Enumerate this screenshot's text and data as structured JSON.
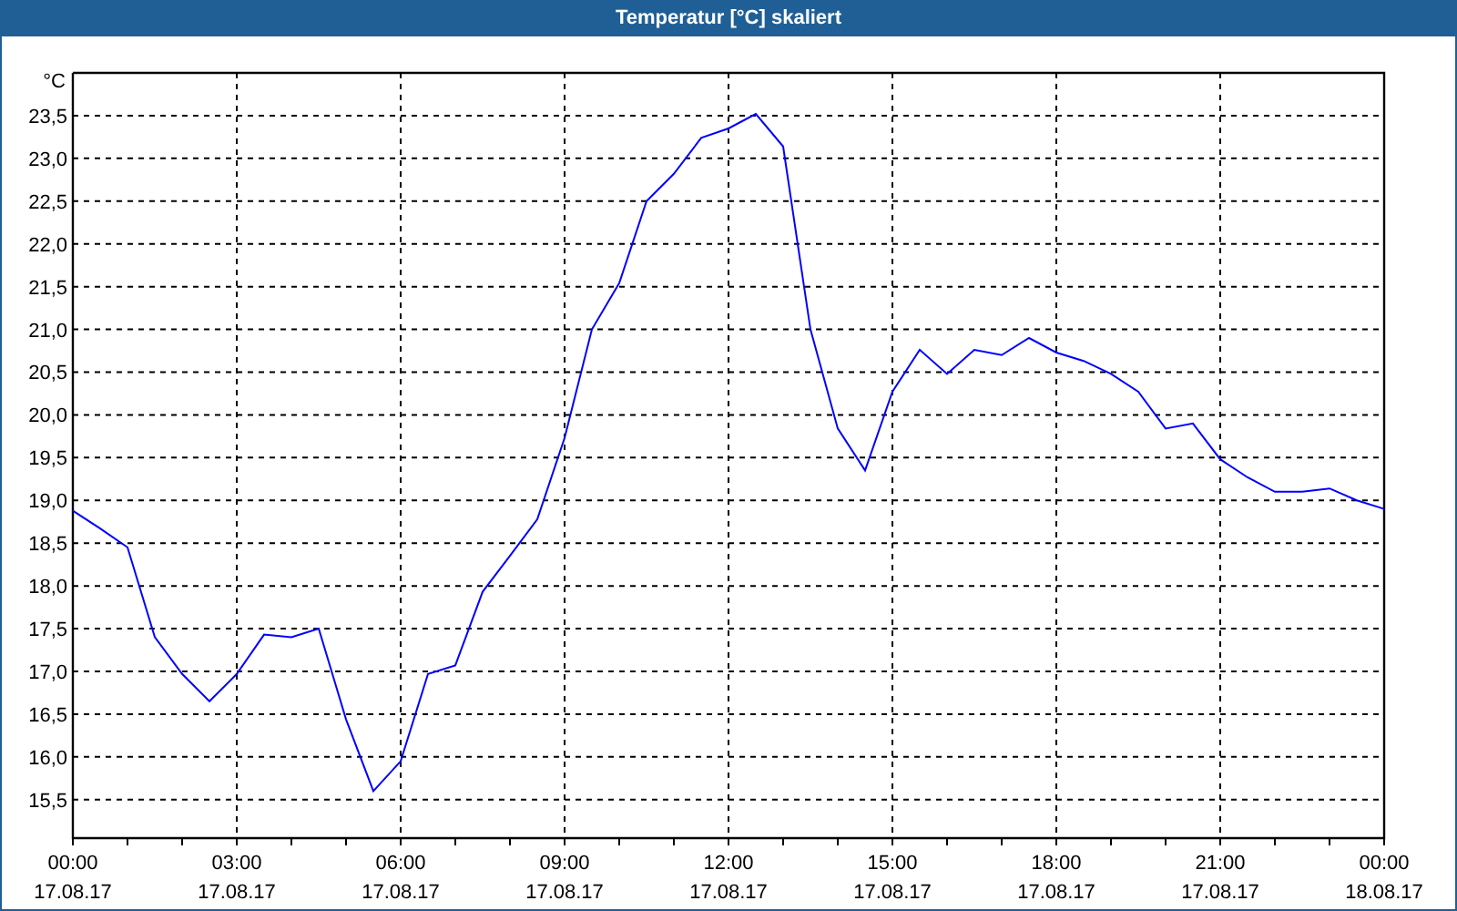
{
  "chart_data": {
    "type": "line",
    "grid": true,
    "title": "Temperatur [°C] skaliert",
    "ylabel": "°C",
    "ylim": [
      15.05,
      24
    ],
    "yticks": [
      {
        "value": 15.5,
        "label": "15,5"
      },
      {
        "value": 16,
        "label": "16,0"
      },
      {
        "value": 16.5,
        "label": "16,5"
      },
      {
        "value": 17,
        "label": "17,0"
      },
      {
        "value": 17.5,
        "label": "17,5"
      },
      {
        "value": 18,
        "label": "18,0"
      },
      {
        "value": 18.5,
        "label": "18,5"
      },
      {
        "value": 19,
        "label": "19,0"
      },
      {
        "value": 19.5,
        "label": "19,5"
      },
      {
        "value": 20,
        "label": "20,0"
      },
      {
        "value": 20.5,
        "label": "20,5"
      },
      {
        "value": 21,
        "label": "21,0"
      },
      {
        "value": 21.5,
        "label": "21,5"
      },
      {
        "value": 22,
        "label": "22,0"
      },
      {
        "value": 22.5,
        "label": "22,5"
      },
      {
        "value": 23,
        "label": "23,0"
      },
      {
        "value": 23.5,
        "label": "23,5"
      }
    ],
    "categories": [
      "00:00 17.08.17",
      null,
      null,
      null,
      null,
      null,
      "03:00 17.08.17",
      null,
      null,
      null,
      null,
      null,
      "06:00 17.08.17",
      null,
      null,
      null,
      null,
      null,
      "09:00 17.08.17",
      null,
      null,
      null,
      null,
      null,
      "12:00 17.08.17",
      null,
      null,
      null,
      null,
      null,
      "15:00 17.08.17",
      null,
      null,
      null,
      null,
      null,
      "18:00 17.08.17",
      null,
      null,
      null,
      null,
      null,
      "21:00 17.08.17",
      null,
      null,
      null,
      null,
      null,
      "00:00 18.08.17"
    ],
    "series": [
      {
        "color": "#0000ff",
        "values": [
          18.88,
          18.67,
          18.45,
          17.4,
          16.97,
          16.65,
          16.97,
          17.43,
          17.4,
          17.5,
          16.44,
          15.6,
          15.95,
          16.97,
          17.07,
          17.93,
          18.35,
          18.78,
          19.73,
          21.0,
          21.54,
          22.5,
          22.82,
          23.24,
          23.35,
          23.52,
          23.14,
          21.0,
          19.84,
          19.35,
          20.27,
          20.76,
          20.48,
          20.76,
          20.7,
          20.9,
          20.73,
          20.63,
          20.48,
          20.27,
          19.84,
          19.9,
          19.48,
          19.27,
          19.1,
          19.1,
          19.14,
          19.0,
          18.9
        ]
      }
    ]
  }
}
